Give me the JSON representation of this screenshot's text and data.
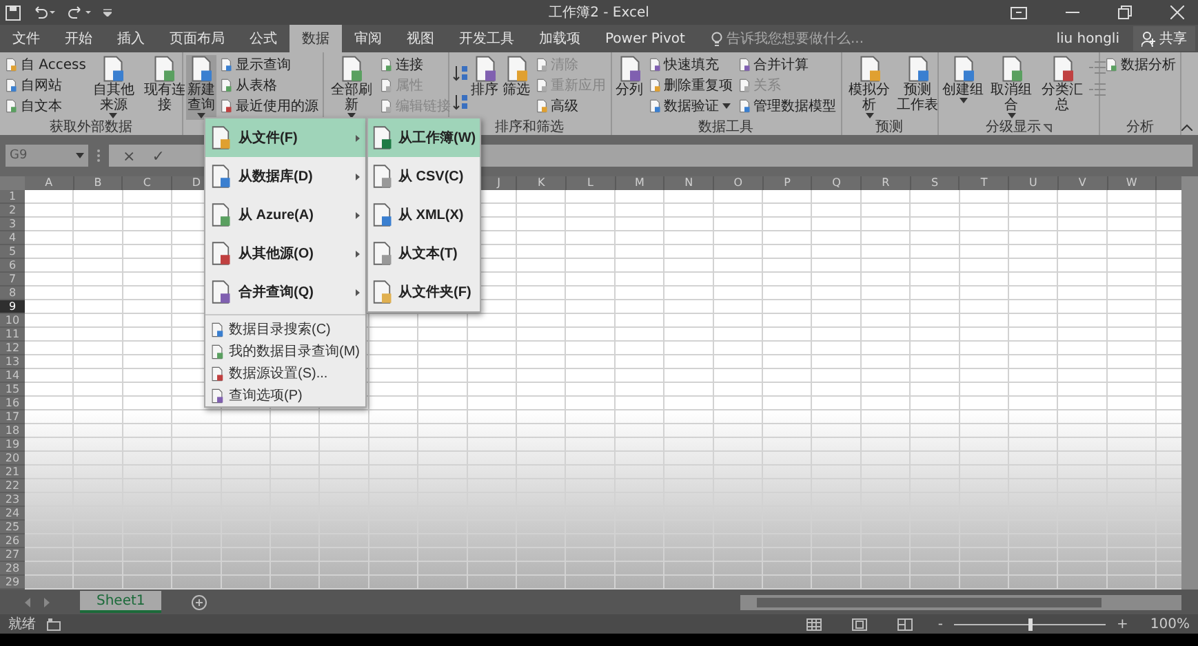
{
  "title_bar": {
    "title": "工作簿2 - Excel"
  },
  "tabs": [
    {
      "label": "文件",
      "selected": false
    },
    {
      "label": "开始",
      "selected": false
    },
    {
      "label": "插入",
      "selected": false
    },
    {
      "label": "页面布局",
      "selected": false
    },
    {
      "label": "公式",
      "selected": false
    },
    {
      "label": "数据",
      "selected": true
    },
    {
      "label": "审阅",
      "selected": false
    },
    {
      "label": "视图",
      "selected": false
    },
    {
      "label": "开发工具",
      "selected": false
    },
    {
      "label": "加载项",
      "selected": false
    },
    {
      "label": "Power Pivot",
      "selected": false
    }
  ],
  "tell_me": {
    "placeholder": "告诉我您想要做什么..."
  },
  "user": "liu hongli",
  "share_button": "共享",
  "ribbon": {
    "groups": [
      {
        "label": "获取外部数据",
        "launcher": false,
        "items": [
          {
            "kind": "stack",
            "buttons": [
              {
                "label": "自 Access",
                "disabled": false,
                "dropdown": false
              },
              {
                "label": "自网站",
                "disabled": false,
                "dropdown": false
              },
              {
                "label": "自文本",
                "disabled": false,
                "dropdown": false
              }
            ]
          },
          {
            "kind": "large",
            "lines": [
              "自其他来源"
            ],
            "dropdown": true,
            "pressed": false
          },
          {
            "kind": "large",
            "lines": [
              "现有连接"
            ],
            "dropdown": false,
            "pressed": false
          }
        ]
      },
      {
        "launcher": false,
        "items": [
          {
            "kind": "large",
            "lines": [
              "新建",
              "查询"
            ],
            "dropdown": true,
            "pressed": true
          },
          {
            "kind": "stack",
            "buttons": [
              {
                "label": "显示查询",
                "disabled": false,
                "dropdown": false
              },
              {
                "label": "从表格",
                "disabled": false,
                "dropdown": false
              },
              {
                "label": "最近使用的源",
                "disabled": false,
                "dropdown": false
              }
            ]
          }
        ]
      },
      {
        "launcher": false,
        "items": [
          {
            "kind": "large",
            "lines": [
              "全部刷新"
            ],
            "dropdown": true,
            "pressed": false
          },
          {
            "kind": "stack",
            "buttons": [
              {
                "label": "连接",
                "disabled": false,
                "dropdown": false
              },
              {
                "label": "属性",
                "disabled": true,
                "dropdown": false
              },
              {
                "label": "编辑链接",
                "disabled": true,
                "dropdown": false
              }
            ]
          }
        ]
      },
      {
        "label": "排序和筛选",
        "launcher": false,
        "items": [
          {
            "kind": "sort"
          },
          {
            "kind": "large",
            "lines": [
              "排序"
            ],
            "dropdown": false,
            "pressed": false
          },
          {
            "kind": "large",
            "lines": [
              "筛选"
            ],
            "dropdown": false,
            "pressed": false
          },
          {
            "kind": "stack",
            "buttons": [
              {
                "label": "清除",
                "disabled": true,
                "dropdown": false
              },
              {
                "label": "重新应用",
                "disabled": true,
                "dropdown": false
              },
              {
                "label": "高级",
                "disabled": false,
                "dropdown": false
              }
            ]
          }
        ]
      },
      {
        "label": "数据工具",
        "launcher": false,
        "items": [
          {
            "kind": "large",
            "lines": [
              "分列"
            ],
            "dropdown": false,
            "pressed": false
          },
          {
            "kind": "stack",
            "buttons": [
              {
                "label": "快速填充",
                "disabled": false,
                "dropdown": false
              },
              {
                "label": "删除重复项",
                "disabled": false,
                "dropdown": false
              },
              {
                "label": "数据验证",
                "disabled": false,
                "dropdown": true
              }
            ]
          },
          {
            "kind": "stack",
            "buttons": [
              {
                "label": "合并计算",
                "disabled": false,
                "dropdown": false
              },
              {
                "label": "关系",
                "disabled": true,
                "dropdown": false
              },
              {
                "label": "管理数据模型",
                "disabled": false,
                "dropdown": false
              }
            ]
          }
        ]
      },
      {
        "label": "预测",
        "launcher": false,
        "items": [
          {
            "kind": "large",
            "lines": [
              "模拟分析"
            ],
            "dropdown": true,
            "pressed": false
          },
          {
            "kind": "large",
            "lines": [
              "预测",
              "工作表"
            ],
            "dropdown": false,
            "pressed": false
          }
        ]
      },
      {
        "label": "分级显示",
        "launcher": true,
        "items": [
          {
            "kind": "large",
            "lines": [
              "创建组"
            ],
            "dropdown": true,
            "pressed": false
          },
          {
            "kind": "large",
            "lines": [
              "取消组合"
            ],
            "dropdown": true,
            "pressed": false
          },
          {
            "kind": "large",
            "lines": [
              "分类汇总"
            ],
            "dropdown": false,
            "pressed": false
          },
          {
            "kind": "mini"
          }
        ]
      },
      {
        "label": "分析",
        "launcher": false,
        "items": [
          {
            "kind": "stack",
            "buttons": [
              {
                "label": "数据分析",
                "disabled": false,
                "dropdown": false
              }
            ]
          }
        ]
      }
    ]
  },
  "name_box": "G9",
  "formula_buttons": [
    "×",
    "✓"
  ],
  "columns_left": [
    "A",
    "B",
    "C",
    "D"
  ],
  "columns_right": [
    "J",
    "K",
    "L",
    "M",
    "N",
    "O",
    "P",
    "Q",
    "R",
    "S",
    "T",
    "U",
    "V",
    "W"
  ],
  "rows": [
    {
      "label": "1",
      "selected": false
    },
    {
      "label": "2",
      "selected": false
    },
    {
      "label": "3",
      "selected": false
    },
    {
      "label": "4",
      "selected": false
    },
    {
      "label": "5",
      "selected": false
    },
    {
      "label": "6",
      "selected": false
    },
    {
      "label": "7",
      "selected": false
    },
    {
      "label": "8",
      "selected": false
    },
    {
      "label": "9",
      "selected": true
    },
    {
      "label": "10",
      "selected": false
    },
    {
      "label": "11",
      "selected": false
    },
    {
      "label": "12",
      "selected": false
    },
    {
      "label": "13",
      "selected": false
    },
    {
      "label": "14",
      "selected": false
    },
    {
      "label": "15",
      "selected": false
    },
    {
      "label": "16",
      "selected": false
    },
    {
      "label": "17",
      "selected": false
    },
    {
      "label": "18",
      "selected": false
    },
    {
      "label": "19",
      "selected": false
    },
    {
      "label": "20",
      "selected": false
    },
    {
      "label": "21",
      "selected": false
    },
    {
      "label": "22",
      "selected": false
    },
    {
      "label": "23",
      "selected": false
    },
    {
      "label": "24",
      "selected": false
    },
    {
      "label": "25",
      "selected": false
    },
    {
      "label": "26",
      "selected": false
    },
    {
      "label": "27",
      "selected": false
    },
    {
      "label": "28",
      "selected": false
    },
    {
      "label": "29",
      "selected": false
    }
  ],
  "menu": {
    "items": [
      {
        "label": "从文件(F)",
        "selected": true
      },
      {
        "label": "从数据库(D)",
        "selected": false
      },
      {
        "label": "从 Azure(A)",
        "selected": false
      },
      {
        "label": "从其他源(O)",
        "selected": false
      },
      {
        "label": "合并查询(Q)",
        "selected": false
      }
    ],
    "footer_items": [
      "数据目录搜索(C)",
      "我的数据目录查询(M)",
      "数据源设置(S)...",
      "查询选项(P)"
    ],
    "submenu": [
      {
        "label": "从工作簿(W)",
        "selected": true
      },
      {
        "label": "从 CSV(C)",
        "selected": false
      },
      {
        "label": "从 XML(X)",
        "selected": false
      },
      {
        "label": "从文本(T)",
        "selected": false
      },
      {
        "label": "从文件夹(F)",
        "selected": false
      }
    ]
  },
  "sheet_tabs": [
    {
      "label": "Sheet1",
      "selected": true
    }
  ],
  "status_bar": {
    "status": "就绪",
    "zoom_out": "-",
    "zoom_in": "+",
    "zoom": {
      "level": 0.5
    },
    "zoom_label": "100%"
  }
}
